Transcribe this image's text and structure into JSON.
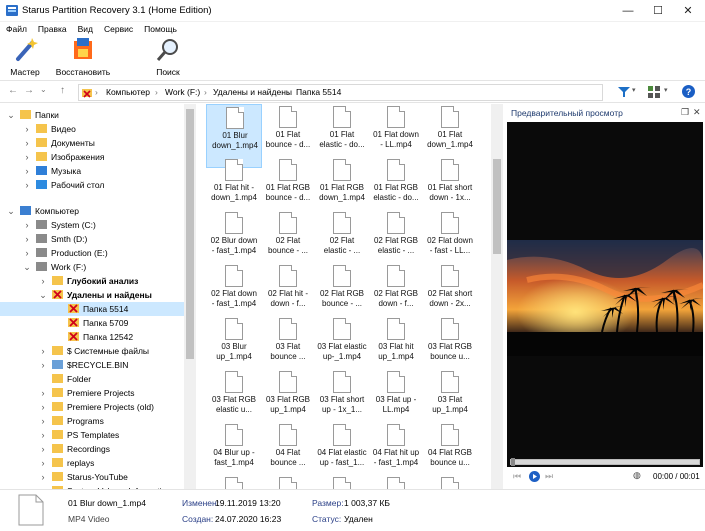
{
  "window": {
    "title": "Starus Partition Recovery 3.1 (Home Edition)",
    "min": "—",
    "max": "☐",
    "close": "✕"
  },
  "menu": [
    "Файл",
    "Правка",
    "Вид",
    "Сервис",
    "Помощь"
  ],
  "toolbar": {
    "master": "Мастер",
    "restore": "Восстановить",
    "search": "Поиск"
  },
  "breadcrumb": [
    "Компьютер",
    "Work (F:)",
    "Удалены и найдены",
    "Папка 5514"
  ],
  "tree": [
    {
      "label": "Папки",
      "icon": "folder-icon",
      "indent": 0,
      "chev": "v",
      "bold": false
    },
    {
      "label": "Видео",
      "icon": "video-folder-icon",
      "indent": 1,
      "chev": ">",
      "bold": false
    },
    {
      "label": "Документы",
      "icon": "documents-folder-icon",
      "indent": 1,
      "chev": ">",
      "bold": false
    },
    {
      "label": "Изображения",
      "icon": "pictures-folder-icon",
      "indent": 1,
      "chev": ">",
      "bold": false
    },
    {
      "label": "Музыка",
      "icon": "music-folder-icon",
      "indent": 1,
      "chev": ">",
      "bold": false
    },
    {
      "label": "Рабочий стол",
      "icon": "desktop-folder-icon",
      "indent": 1,
      "chev": ">",
      "bold": false
    },
    {
      "label": "Компьютер",
      "icon": "computer-icon",
      "indent": 0,
      "chev": "v",
      "bold": false
    },
    {
      "label": "System (C:)",
      "icon": "drive-icon",
      "indent": 1,
      "chev": ">",
      "bold": false
    },
    {
      "label": "Smth (D:)",
      "icon": "drive-icon",
      "indent": 1,
      "chev": ">",
      "bold": false
    },
    {
      "label": "Production (E:)",
      "icon": "drive-icon",
      "indent": 1,
      "chev": ">",
      "bold": false
    },
    {
      "label": "Work (F:)",
      "icon": "drive-icon",
      "indent": 1,
      "chev": "v",
      "bold": false
    },
    {
      "label": "Глубокий анализ",
      "icon": "deep-analysis-folder-icon",
      "indent": 2,
      "chev": ">",
      "bold": true
    },
    {
      "label": "Удалены и найдены",
      "icon": "deleted-folder-icon",
      "indent": 2,
      "chev": "v",
      "bold": true
    },
    {
      "label": "Папка 5514",
      "icon": "deleted-folder-icon",
      "indent": 3,
      "chev": "",
      "bold": false,
      "sel": true
    },
    {
      "label": "Папка 5709",
      "icon": "deleted-folder-icon",
      "indent": 3,
      "chev": "",
      "bold": false
    },
    {
      "label": "Папка 12542",
      "icon": "deleted-folder-icon",
      "indent": 3,
      "chev": "",
      "bold": false
    },
    {
      "label": "$ Системные файлы",
      "icon": "folder-icon",
      "indent": 2,
      "chev": ">",
      "bold": false
    },
    {
      "label": "$RECYCLE.BIN",
      "icon": "recycle-bin-icon",
      "indent": 2,
      "chev": ">",
      "bold": false
    },
    {
      "label": "Folder",
      "icon": "folder-icon",
      "indent": 2,
      "chev": "",
      "bold": false
    },
    {
      "label": "Premiere Projects",
      "icon": "folder-icon",
      "indent": 2,
      "chev": ">",
      "bold": false
    },
    {
      "label": "Premiere Projects (old)",
      "icon": "folder-icon",
      "indent": 2,
      "chev": ">",
      "bold": false
    },
    {
      "label": "Programs",
      "icon": "folder-icon",
      "indent": 2,
      "chev": ">",
      "bold": false
    },
    {
      "label": "PS Templates",
      "icon": "folder-icon",
      "indent": 2,
      "chev": ">",
      "bold": false
    },
    {
      "label": "Recordings",
      "icon": "folder-icon",
      "indent": 2,
      "chev": ">",
      "bold": false
    },
    {
      "label": "replays",
      "icon": "folder-icon",
      "indent": 2,
      "chev": ">",
      "bold": false
    },
    {
      "label": "Starus-YouTube",
      "icon": "folder-icon",
      "indent": 2,
      "chev": ">",
      "bold": false
    },
    {
      "label": "System Volume Information",
      "icon": "folder-icon",
      "indent": 2,
      "chev": ">",
      "bold": false
    }
  ],
  "files": [
    [
      "01 Blur",
      "down_1.mp4"
    ],
    [
      "01 Flat",
      "bounce - d..."
    ],
    [
      "01 Flat",
      "elastic - do..."
    ],
    [
      "01 Flat down",
      "- LL.mp4"
    ],
    [
      "01 Flat",
      "down_1.mp4"
    ],
    [
      "01 Flat hit -",
      "down_1.mp4"
    ],
    [
      "01 Flat RGB",
      "bounce - d..."
    ],
    [
      "01 Flat RGB",
      "down_1.mp4"
    ],
    [
      "01 Flat RGB",
      "elastic - do..."
    ],
    [
      "01 Flat short",
      "down - 1x..."
    ],
    [
      "02 Blur down",
      "- fast_1.mp4"
    ],
    [
      "02 Flat",
      "bounce - ..."
    ],
    [
      "02 Flat",
      "elastic - ..."
    ],
    [
      "02 Flat  RGB",
      "elastic - ..."
    ],
    [
      "02 Flat down",
      "- fast - LL..."
    ],
    [
      "02 Flat down",
      "- fast_1.mp4"
    ],
    [
      "02 Flat hit -",
      "down - f..."
    ],
    [
      "02 Flat RGB",
      "bounce - ..."
    ],
    [
      "02 Flat RGB",
      "down - f..."
    ],
    [
      "02 Flat short",
      "down - 2x..."
    ],
    [
      "03 Blur",
      "up_1.mp4"
    ],
    [
      "03 Flat",
      "bounce ..."
    ],
    [
      "03 Flat elastic",
      "up-_1.mp4"
    ],
    [
      "03 Flat hit",
      "up_1.mp4"
    ],
    [
      "03 Flat RGB",
      "bounce u..."
    ],
    [
      "03 Flat RGB",
      "elastic  u..."
    ],
    [
      "03 Flat RGB",
      "up_1.mp4"
    ],
    [
      "03 Flat short",
      "up - 1x_1..."
    ],
    [
      "03 Flat up -",
      "LL.mp4"
    ],
    [
      "03 Flat",
      "up_1.mp4"
    ],
    [
      "04 Blur up -",
      "fast_1.mp4"
    ],
    [
      "04 Flat",
      "bounce ..."
    ],
    [
      "04 Flat elastic",
      "up - fast_1..."
    ],
    [
      "04 Flat hit up",
      "- fast_1.mp4"
    ],
    [
      "04 Flat RGB",
      "bounce u..."
    ],
    [
      "",
      ""
    ],
    [
      "",
      ""
    ],
    [
      "",
      ""
    ],
    [
      "",
      ""
    ],
    [
      "",
      ""
    ]
  ],
  "preview": {
    "title": "Предварительный просмотр",
    "time": "00:00 / 00:01"
  },
  "status": {
    "filename": "01 Blur down_1.mp4",
    "filetype": "MP4 Video",
    "modified_label": "Изменен:",
    "modified_value": "19.11.2019 13:20",
    "created_label": "Создан:",
    "created_value": "24.07.2020 16:23",
    "size_label": "Размер:",
    "size_value": "1 003,37 КБ",
    "state_label": "Статус:",
    "state_value": "Удален"
  }
}
